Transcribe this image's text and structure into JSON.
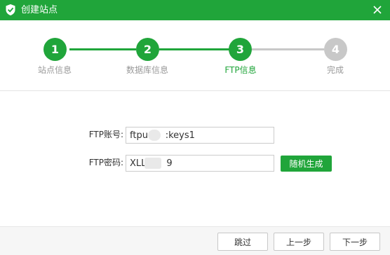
{
  "window": {
    "title": "创建站点",
    "icon": "shield-icon",
    "close_icon": "close-icon"
  },
  "steps": [
    {
      "number": "1",
      "label": "站点信息",
      "state": "done"
    },
    {
      "number": "2",
      "label": "数据库信息",
      "state": "done"
    },
    {
      "number": "3",
      "label": "FTP信息",
      "state": "active"
    },
    {
      "number": "4",
      "label": "完成",
      "state": "pending"
    }
  ],
  "form": {
    "ftp_account_label": "FTP账号:",
    "ftp_account_value": "ftpu      :keys1",
    "ftp_password_label": "FTP密码:",
    "ftp_password_value": "XLL       9",
    "generate_button": "随机生成"
  },
  "footer": {
    "skip_button": "跳过",
    "prev_button": "上一步",
    "next_button": "下一步"
  },
  "colors": {
    "accent": "#20a53a",
    "step_done": "#20a53a",
    "step_pending": "#c8c8c8",
    "active_label": "#20a53a",
    "inactive_label": "#999999"
  }
}
